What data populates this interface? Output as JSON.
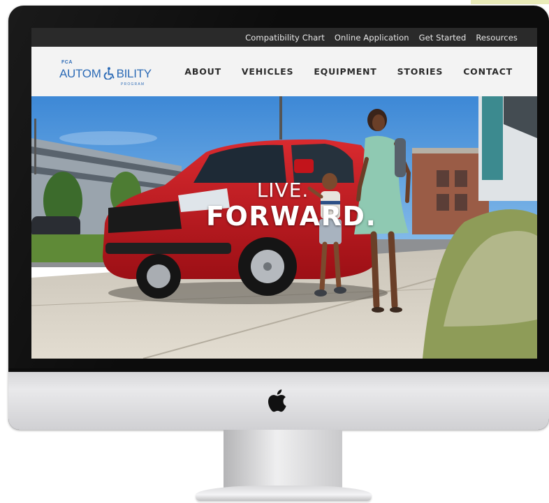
{
  "top_links": [
    "Compatibility Chart",
    "Online Application",
    "Get Started",
    "Resources"
  ],
  "logo": {
    "fca": "FCA",
    "word_before": "AUTOM",
    "word_after": "BILITY",
    "program": "PROGRAM"
  },
  "nav": [
    "ABOUT",
    "VEHICLES",
    "EQUIPMENT",
    "STORIES",
    "CONTACT"
  ],
  "hero": {
    "line1": "LIVE.",
    "line2": "FORWARD."
  },
  "colors": {
    "topbar": "#2a2a2a",
    "navbar": "#f3f3f3",
    "brand_blue": "#2d6bb6",
    "van_red": "#c8161f"
  },
  "icons": {
    "logo_symbol": "wheelchair-icon",
    "device_logo": "apple-icon"
  }
}
